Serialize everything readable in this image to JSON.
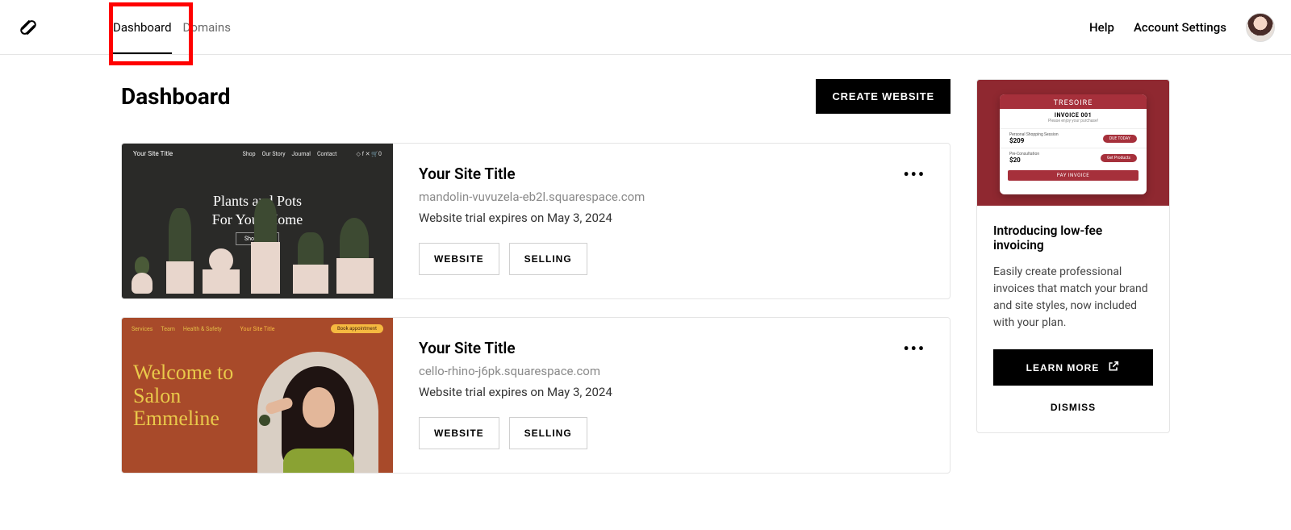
{
  "nav": {
    "tabs": [
      "Dashboard",
      "Domains"
    ],
    "right": {
      "help": "Help",
      "account": "Account Settings"
    }
  },
  "page": {
    "title": "Dashboard",
    "create_btn": "CREATE WEBSITE"
  },
  "sites": [
    {
      "title": "Your Site Title",
      "domain": "mandolin-vuvuzela-eb2l.squarespace.com",
      "status": "Website trial expires on May 3, 2024",
      "actions": [
        "WEBSITE",
        "SELLING"
      ],
      "thumb": {
        "brand": "Your Site Title",
        "navlinks": [
          "Shop",
          "Our Story",
          "Journal",
          "Contact"
        ],
        "hero1": "Plants and Pots",
        "hero2": "For Your Home",
        "cta": "Shop Now"
      }
    },
    {
      "title": "Your Site Title",
      "domain": "cello-rhino-j6pk.squarespace.com",
      "status": "Website trial expires on May 3, 2024",
      "actions": [
        "WEBSITE",
        "SELLING"
      ],
      "thumb": {
        "brand": "Your Site Title",
        "navlinks": [
          "Services",
          "Team",
          "Health & Safety"
        ],
        "cta": "Book appointment",
        "hero1": "Welcome to",
        "hero2": "Salon",
        "hero3": "Emmeline"
      }
    }
  ],
  "promo": {
    "invoice": {
      "brand": "TRESOIRE",
      "title": "INVOICE 001",
      "subtitle": "Please enjoy your purchase!",
      "rows": [
        {
          "label": "Personal Shopping Session",
          "amount": "$209",
          "pill": "DUE TODAY"
        },
        {
          "label": "Pre-Consultation",
          "amount": "$20",
          "pill": "Get Products"
        }
      ],
      "paybtn": "PAY INVOICE"
    },
    "title": "Introducing low-fee invoicing",
    "text": "Easily create professional invoices that match your brand and site styles, now included with your plan.",
    "learn": "LEARN MORE",
    "dismiss": "DISMISS"
  }
}
